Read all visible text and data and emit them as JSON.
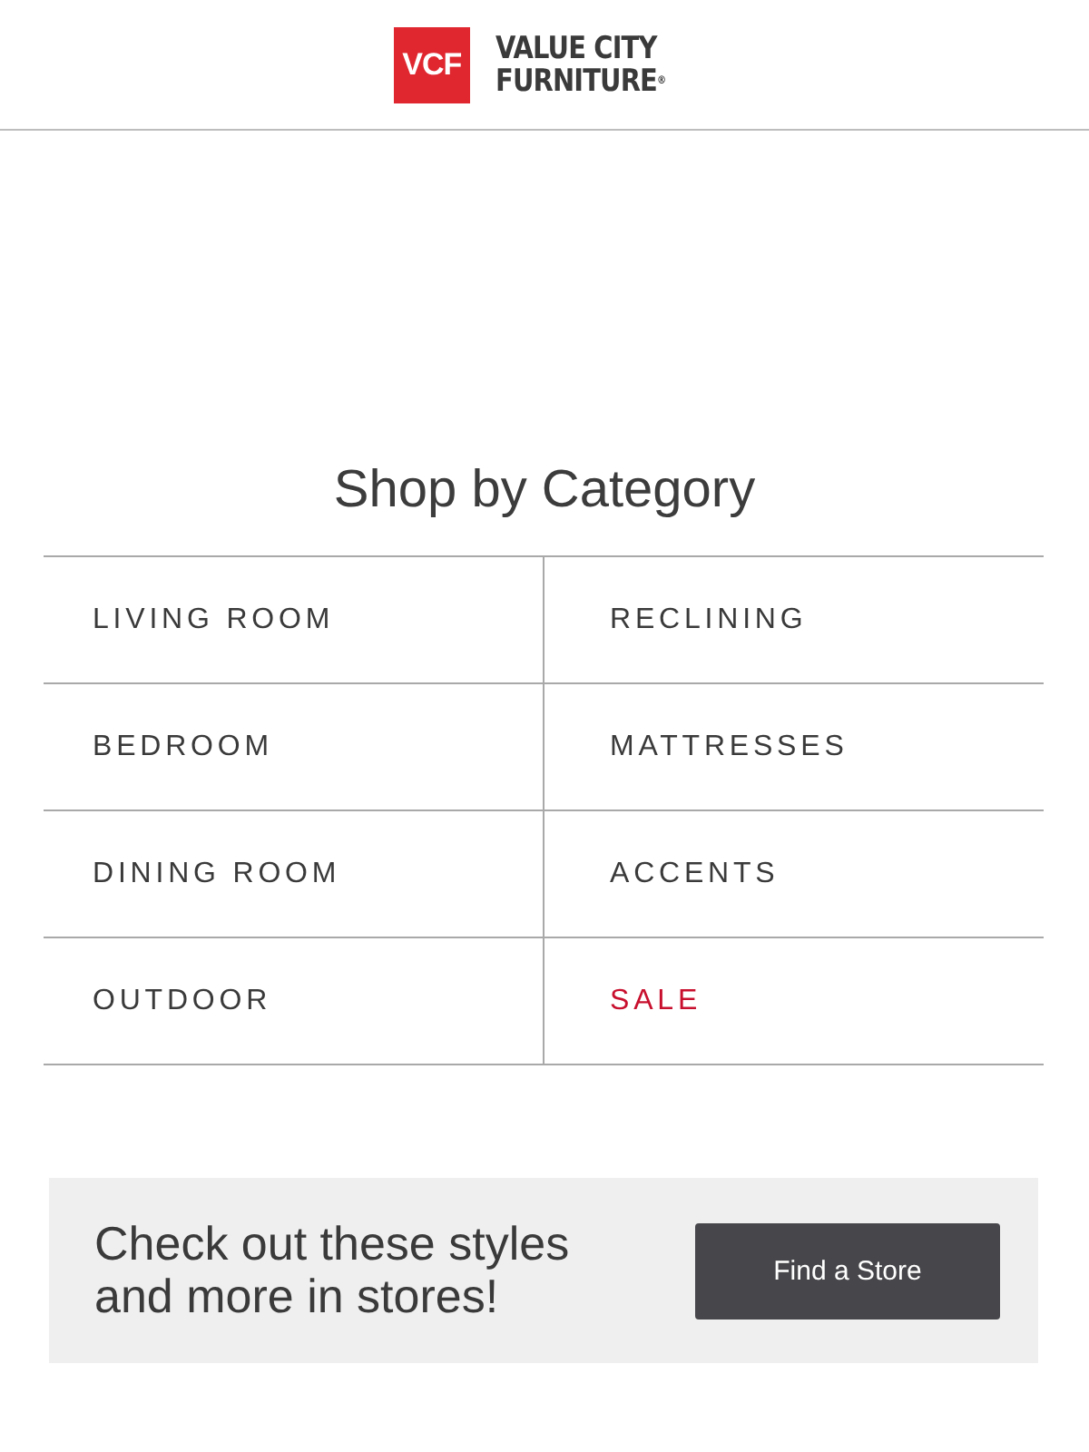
{
  "header": {
    "logo_mark": "VCF",
    "logo_line_1": "VALUE CITY",
    "logo_line_2": "FURNITURE$^{®}$"
  },
  "section": {
    "title": "Shop by Category",
    "categories": [
      {
        "label": "LIVING ROOM",
        "kind": "normal"
      },
      {
        "label": "RECLINING",
        "kind": "normal"
      },
      {
        "label": "BEDROOM",
        "kind": "normal"
      },
      {
        "label": "MATTRESSES",
        "kind": "normal"
      },
      {
        "label": "DINING ROOM",
        "kind": "normal"
      },
      {
        "label": "ACCENTS",
        "kind": "normal"
      },
      {
        "label": "OUTDOOR",
        "kind": "normal"
      },
      {
        "label": "SALE",
        "kind": "sale"
      }
    ]
  },
  "promo": {
    "text": "Check out these styles and more in stores!",
    "button": "Find a Store"
  }
}
